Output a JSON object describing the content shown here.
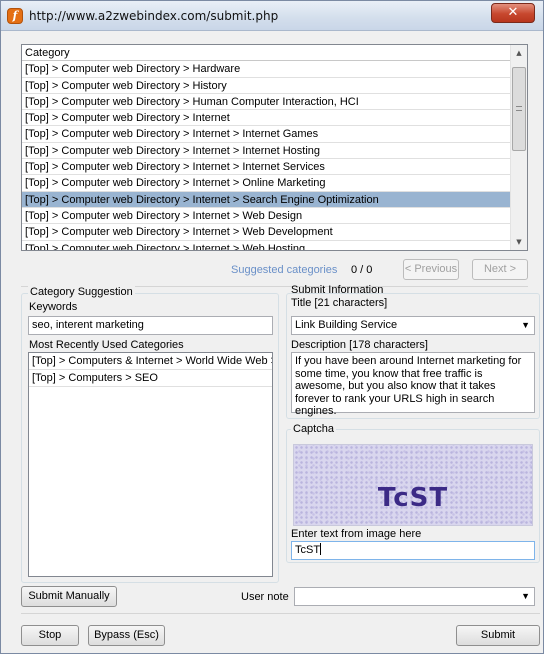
{
  "window": {
    "title": "http://www.a2zwebindex.com/submit.php",
    "close_symbol": "✕"
  },
  "category_list": {
    "header": "Category",
    "items": [
      "[Top] > Computer web Directory > Hardware",
      "[Top] > Computer web Directory > History",
      "[Top] > Computer web Directory > Human Computer Interaction, HCI",
      "[Top] > Computer web Directory > Internet",
      "[Top] > Computer web Directory > Internet > Internet Games",
      "[Top] > Computer web Directory > Internet > Internet Hosting",
      "[Top] > Computer web Directory > Internet > Internet Services",
      "[Top] > Computer web Directory > Internet > Online Marketing",
      "[Top] > Computer web Directory > Internet > Search Engine Optimization",
      "[Top] > Computer web Directory > Internet > Web Design",
      "[Top] > Computer web Directory > Internet > Web Development",
      "[Top] > Computer web Directory > Internet > Web Hosting"
    ],
    "selected_index": 8
  },
  "suggestions": {
    "label": "Suggested categories",
    "count": "0  /  0",
    "previous_label": "< Previous",
    "next_label": "Next >"
  },
  "category_suggestion": {
    "legend": "Category Suggestion",
    "keywords_label": "Keywords",
    "keywords_value": "seo, interent marketing",
    "mru_label": "Most Recently Used Categories",
    "mru_items": [
      "[Top] > Computers & Internet > World Wide Web > ...",
      "[Top] > Computers > SEO"
    ]
  },
  "submit_info": {
    "legend": "Submit Information",
    "title_label": "Title [21 characters]",
    "title_value": "Link Building Service",
    "description_label": "Description [178 characters]",
    "description_value": "If you have been around Internet marketing for some time, you know that free traffic is awesome, but you also know that it takes forever to rank your URLS high in search engines."
  },
  "captcha": {
    "legend": "Captcha",
    "image_text": "TcST",
    "prompt": "Enter text from image here",
    "value": "TcST"
  },
  "bottom": {
    "submit_manually": "Submit Manually",
    "user_note_label": "User note",
    "user_note_value": "",
    "stop": "Stop",
    "bypass": "Bypass (Esc)",
    "submit": "Submit"
  },
  "colors": {
    "selection": "#99b4d1",
    "suggest_label": "#6a90c8",
    "captcha_text": "#3b2a86"
  }
}
